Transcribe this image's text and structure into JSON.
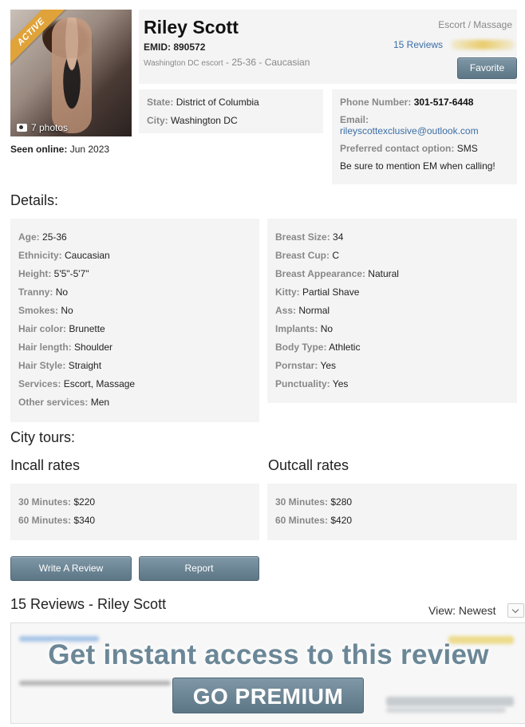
{
  "profile": {
    "badge": "ACTIVE",
    "photo_count": "7 photos",
    "seen_label": "Seen online:",
    "seen_value": "Jun 2023",
    "name": "Riley Scott",
    "emid": "EMID: 890572",
    "subline_small": "Washington DC escort",
    "subline_rest": " - 25-36 - Caucasian",
    "category": "Escort / Massage",
    "reviews_link": "15 Reviews",
    "favorite_label": "Favorite"
  },
  "location": {
    "state_label": "State:",
    "state_value": "District of Columbia",
    "city_label": "City:",
    "city_value": "Washington DC"
  },
  "contact": {
    "phone_label": "Phone Number:",
    "phone_value": "301-517-6448",
    "email_label": "Email:",
    "email_value": "rileyscottexclusive@outlook.com",
    "pref_label": "Preferred contact option:",
    "pref_value": "SMS",
    "note": "Be sure to mention EM when calling!"
  },
  "details": {
    "title": "Details:",
    "left": [
      {
        "label": "Age:",
        "value": "25-36"
      },
      {
        "label": "Ethnicity:",
        "value": "Caucasian"
      },
      {
        "label": "Height:",
        "value": "5'5\"-5'7\""
      },
      {
        "label": "Tranny:",
        "value": "No"
      },
      {
        "label": "Smokes:",
        "value": "No"
      },
      {
        "label": "Hair color:",
        "value": "Brunette"
      },
      {
        "label": "Hair length:",
        "value": "Shoulder"
      },
      {
        "label": "Hair Style:",
        "value": "Straight"
      },
      {
        "label": "Services:",
        "value": "Escort, Massage"
      },
      {
        "label": "Other services:",
        "value": "Men"
      }
    ],
    "right": [
      {
        "label": "Breast Size:",
        "value": "34"
      },
      {
        "label": "Breast Cup:",
        "value": "C"
      },
      {
        "label": "Breast Appearance:",
        "value": "Natural"
      },
      {
        "label": "Kitty:",
        "value": "Partial Shave"
      },
      {
        "label": "Ass:",
        "value": "Normal"
      },
      {
        "label": "Implants:",
        "value": "No"
      },
      {
        "label": "Body Type:",
        "value": "Athletic"
      },
      {
        "label": "Pornstar:",
        "value": "Yes"
      },
      {
        "label": "Punctuality:",
        "value": "Yes"
      }
    ]
  },
  "tours": {
    "title": "City tours:"
  },
  "rates": {
    "incall_title": "Incall rates",
    "outcall_title": "Outcall rates",
    "incall": [
      {
        "label": "30 Minutes:",
        "value": "$220"
      },
      {
        "label": "60 Minutes:",
        "value": "$340"
      }
    ],
    "outcall": [
      {
        "label": "30 Minutes:",
        "value": "$280"
      },
      {
        "label": "60 Minutes:",
        "value": "$420"
      }
    ]
  },
  "actions": {
    "write_review": "Write A Review",
    "report": "Report"
  },
  "reviews": {
    "title": "15 Reviews - Riley Scott",
    "view_label": "View: Newest",
    "promo_text": "Get instant access to this review",
    "premium_label": "GO PREMIUM"
  },
  "colors": {
    "accent_button": "#6a8494",
    "badge": "#e0a33a",
    "link": "#3a6ea5",
    "panel_bg": "#f4f4f4"
  }
}
